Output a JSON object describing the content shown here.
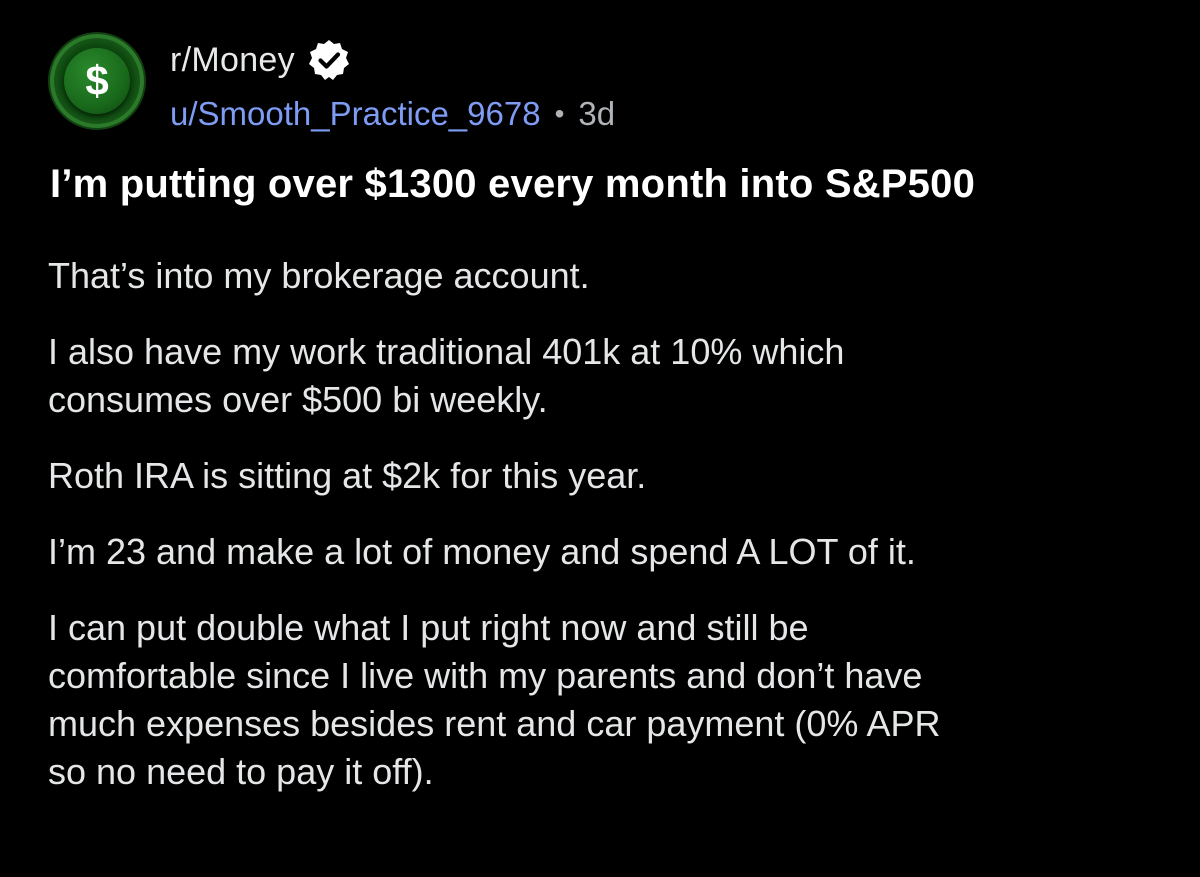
{
  "post": {
    "subreddit": "r/Money",
    "username": "u/Smooth_Practice_9678",
    "separator": "•",
    "age": "3d",
    "title": "I’m putting over $1300 every month into S&P500",
    "avatar_symbol": "$",
    "body": [
      "That’s into my brokerage account.",
      "I also have my work traditional 401k at 10% which\nconsumes over $500 bi weekly.",
      "Roth IRA is sitting at $2k for this year.",
      "I’m 23 and make a lot of money and spend A LOT of it.",
      "I can put double what I put right now and still be\ncomfortable since I live with my parents and don’t have\nmuch expenses besides rent and car payment (0% APR\nso no need to pay it off)."
    ]
  },
  "icons": {
    "avatar": "dollar-icon",
    "badge": "verified-icon"
  },
  "colors": {
    "background": "#000000",
    "username": "#7f9cf5",
    "avatar_green": "#196a1b"
  }
}
